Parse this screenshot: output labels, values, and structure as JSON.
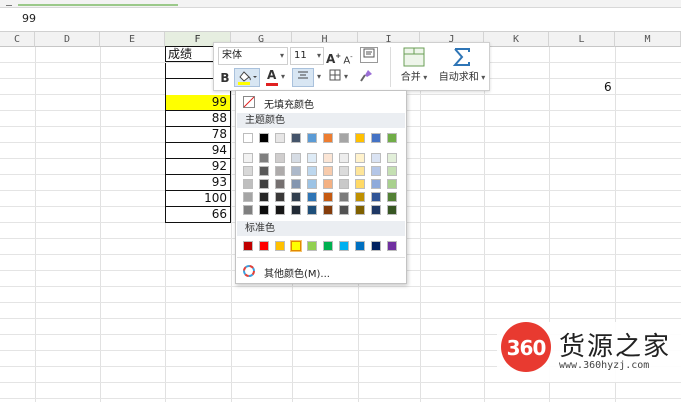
{
  "formula_bar": {
    "value": "99"
  },
  "columns": [
    "C",
    "D",
    "E",
    "F",
    "G",
    "H",
    "I",
    "J",
    "K",
    "L",
    "M"
  ],
  "cells": {
    "header": "成绩",
    "values": [
      "",
      "99",
      "88",
      "78",
      "94",
      "92",
      "93",
      "100",
      "66"
    ],
    "other_value": "6"
  },
  "mini_toolbar": {
    "font_name": "宋体",
    "font_size": "11",
    "grow_font": "A",
    "shrink_font": "A",
    "bold": "B",
    "font_color_letter": "A",
    "merge_label": "合并",
    "autosum_label": "自动求和",
    "accent_color": "#2e75b6"
  },
  "color_menu": {
    "no_fill": "无填充颜色",
    "theme_label": "主题颜色",
    "standard_label": "标准色",
    "more_colors": "其他颜色(M)...",
    "theme_colors": [
      "#ffffff",
      "#000000",
      "#e7e6e6",
      "#44546a",
      "#5b9bd5",
      "#ed7d31",
      "#a5a5a5",
      "#ffc000",
      "#4472c4",
      "#70ad47"
    ],
    "shade_rows": [
      [
        "#f2f2f2",
        "#7f7f7f",
        "#d0cece",
        "#d6dce4",
        "#deebf6",
        "#fbe5d5",
        "#ededed",
        "#fff2cc",
        "#dae3f3",
        "#e2efd9"
      ],
      [
        "#d8d8d8",
        "#595959",
        "#aeabab",
        "#adb9ca",
        "#bdd7ee",
        "#f7cbac",
        "#dbdbdb",
        "#fee599",
        "#b4c6e7",
        "#c5e0b3"
      ],
      [
        "#bfbfbf",
        "#3f3f3f",
        "#757070",
        "#8496b0",
        "#9cc3e5",
        "#f4b183",
        "#c9c9c9",
        "#ffd965",
        "#8eaadb",
        "#a8d08d"
      ],
      [
        "#a5a5a5",
        "#262626",
        "#3a3838",
        "#323f4f",
        "#2e75b5",
        "#c55a11",
        "#7b7b7b",
        "#bf9000",
        "#2f5496",
        "#538135"
      ],
      [
        "#7f7f7f",
        "#0c0c0c",
        "#171616",
        "#222a35",
        "#1e4e79",
        "#843c0b",
        "#525252",
        "#7f6000",
        "#1f3864",
        "#375623"
      ]
    ],
    "standard_colors": [
      "#c00000",
      "#ff0000",
      "#ffc000",
      "#ffff00",
      "#92d050",
      "#00b050",
      "#00b0f0",
      "#0070c0",
      "#002060",
      "#7030a0"
    ],
    "selected_standard": "#ffff00"
  },
  "watermark": {
    "logo_text": "360",
    "brand": "货源之家",
    "url": "www.360hyzj.com"
  }
}
